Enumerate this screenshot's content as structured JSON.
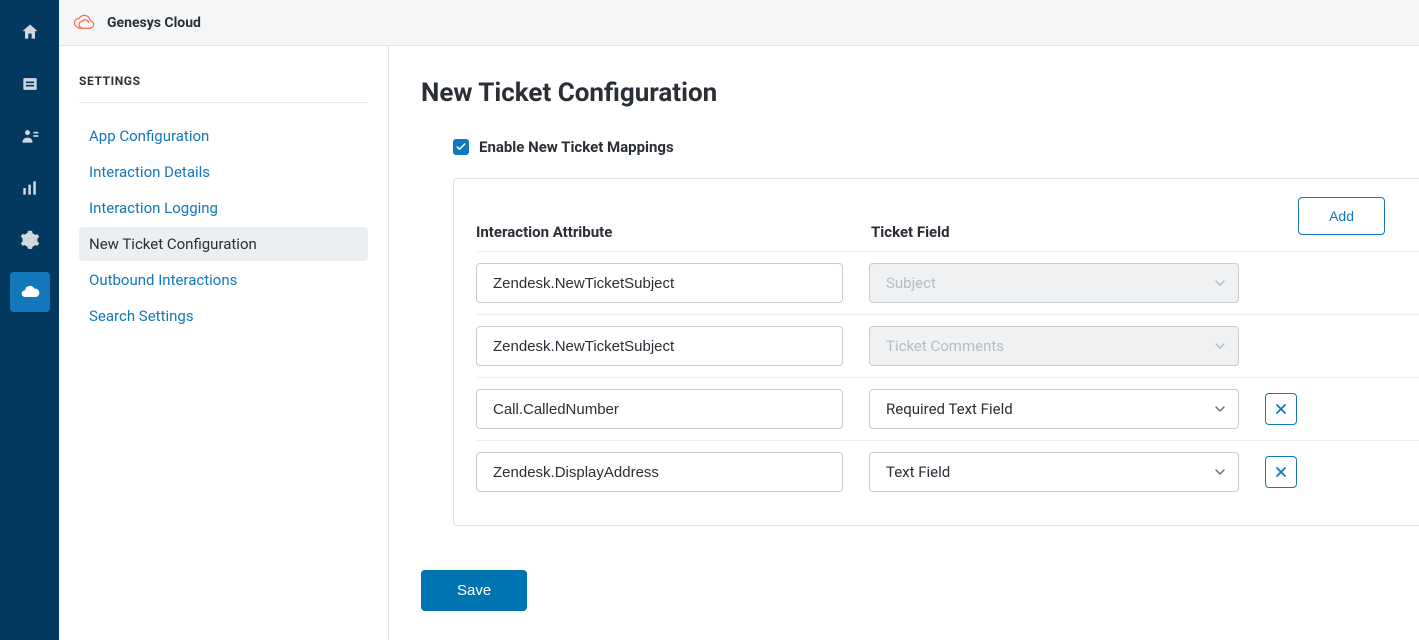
{
  "brand": {
    "name": "Genesys Cloud"
  },
  "rail": {
    "items": [
      {
        "name": "home-icon"
      },
      {
        "name": "tickets-icon"
      },
      {
        "name": "users-icon"
      },
      {
        "name": "analytics-icon"
      },
      {
        "name": "gear-icon"
      },
      {
        "name": "cloud-icon"
      }
    ],
    "activeIndex": 5
  },
  "sidebar": {
    "title": "SETTINGS",
    "items": [
      {
        "label": "App Configuration"
      },
      {
        "label": "Interaction Details"
      },
      {
        "label": "Interaction Logging"
      },
      {
        "label": "New Ticket Configuration"
      },
      {
        "label": "Outbound Interactions"
      },
      {
        "label": "Search Settings"
      }
    ],
    "currentIndex": 3
  },
  "page": {
    "title": "New Ticket Configuration",
    "enable_label": "Enable New Ticket Mappings",
    "enabled": true,
    "table": {
      "col_attr": "Interaction Attribute",
      "col_field": "Ticket Field",
      "add_label": "Add"
    },
    "rows": [
      {
        "attribute": "Zendesk.NewTicketSubject",
        "field": "Subject",
        "disabled": true,
        "removable": false
      },
      {
        "attribute": "Zendesk.NewTicketSubject",
        "field": "Ticket Comments",
        "disabled": true,
        "removable": false
      },
      {
        "attribute": "Call.CalledNumber",
        "field": "Required Text Field",
        "disabled": false,
        "removable": true
      },
      {
        "attribute": "Zendesk.DisplayAddress",
        "field": "Text Field",
        "disabled": false,
        "removable": true
      }
    ],
    "save_label": "Save"
  },
  "colors": {
    "rail_bg": "#03395f",
    "rail_active": "#1378bb",
    "link": "#1378bb",
    "primary_button": "#0073b1",
    "brand_logo": "#fa6a55"
  }
}
